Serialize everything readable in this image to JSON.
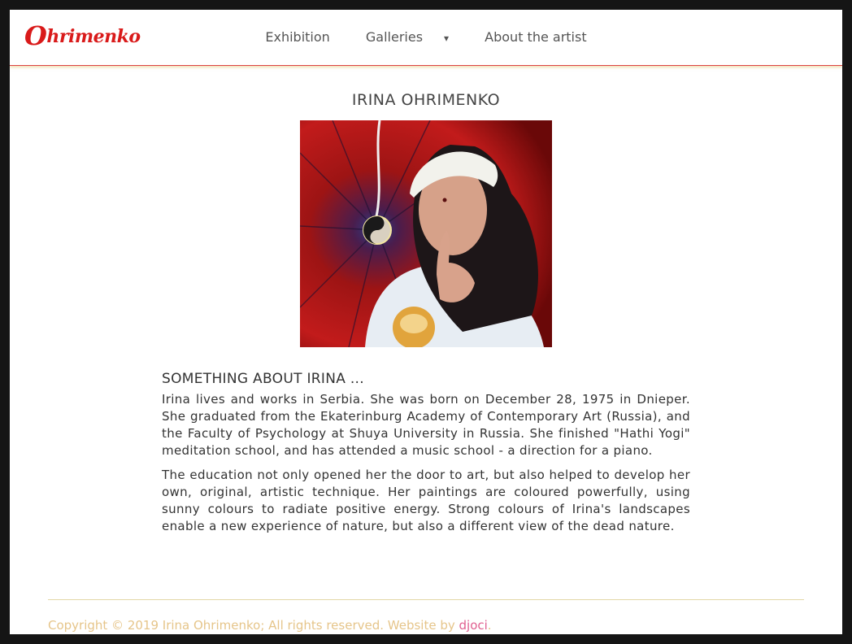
{
  "brand": {
    "logo_text": "hrimenko",
    "logo_initial": "O"
  },
  "nav": {
    "exhibition": "Exhibition",
    "galleries": "Galleries",
    "galleries_caret": "▾",
    "about": "About the artist"
  },
  "page": {
    "title": "IRINA OHRIMENKO",
    "portrait_alt": "Portrait of Irina Ohrimenko with an apple in front of a painting",
    "section_heading": "SOMETHING ABOUT IRINA ...",
    "paragraph_1": "Irina lives and works in Serbia. She was born on December 28, 1975 in Dnieper. She graduated from the Ekaterinburg Academy of Contemporary Art (Russia), and the Faculty of Psychology at Shuya University in Russia. She finished \"Hathi Yogi\" meditation school, and has attended a music school - a direction for a piano.",
    "paragraph_2": "The education not only opened her the door to art, but also helped to develop her own, original, artistic technique. Her paintings are coloured powerfully, using sunny colours to radiate positive energy. Strong colours of Irina's landscapes enable a new experience of nature, but also a different view of the dead nature."
  },
  "footer": {
    "copyright": "Copyright © 2019 Irina Ohrimenko; All rights reserved. Website by ",
    "credit_link": "djoci",
    "end": "."
  },
  "colors": {
    "brand_red": "#d91a1a",
    "footer_text": "#e6c58a",
    "footer_link": "#e06090",
    "frame": "#151515"
  }
}
